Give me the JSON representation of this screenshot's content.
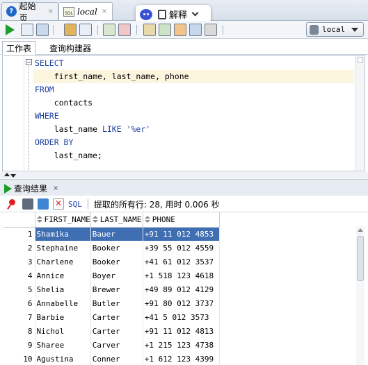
{
  "tabs": [
    {
      "label": "起始页",
      "closable": "×"
    },
    {
      "label": "local",
      "closable": "×"
    }
  ],
  "explain_widget": {
    "label": "解释",
    "icon": "robot-icon"
  },
  "toolbar": {
    "connection": {
      "value": "local"
    },
    "icons": [
      "run-statement-icon",
      "run-script-icon",
      "autotrace-icon",
      "explain-plan-icon",
      "commit-icon",
      "rollback-icon",
      "sql-tuning-icon",
      "format-icon",
      "clear-icon",
      "history-icon",
      "debug-icon"
    ]
  },
  "subtabs": [
    "工作表",
    "查询构建器"
  ],
  "editor": {
    "lines": [
      {
        "kw": "SELECT",
        "rest": ""
      },
      {
        "kw": "",
        "rest": "    first_name, last_name, phone"
      },
      {
        "kw": "FROM",
        "rest": ""
      },
      {
        "kw": "",
        "rest": "    contacts"
      },
      {
        "kw": "WHERE",
        "rest": ""
      },
      {
        "kw": "",
        "rest": "    last_name LIKE '%er'"
      },
      {
        "kw": "ORDER BY",
        "rest": ""
      },
      {
        "kw": "",
        "rest": "    last_name;"
      }
    ]
  },
  "results": {
    "tab_label": "查询结果",
    "tab_close": "×",
    "sql_label": "SQL",
    "status": "提取的所有行: 28, 用时 0.006 秒",
    "columns": [
      "FIRST_NAME",
      "LAST_NAME",
      "PHONE"
    ],
    "rows": [
      [
        "1",
        "Shamika",
        "Bauer",
        "+91 11 012 4853"
      ],
      [
        "2",
        "Stephaine",
        "Booker",
        "+39 55 012 4559"
      ],
      [
        "3",
        "Charlene",
        "Booker",
        "+41 61 012 3537"
      ],
      [
        "4",
        "Annice",
        "Boyer",
        "+1 518 123 4618"
      ],
      [
        "5",
        "Shelia",
        "Brewer",
        "+49 89 012 4129"
      ],
      [
        "6",
        "Annabelle",
        "Butler",
        "+91 80 012 3737"
      ],
      [
        "7",
        "Barbie",
        "Carter",
        "+41 5 012 3573"
      ],
      [
        "8",
        "Nichol",
        "Carter",
        "+91 11 012 4813"
      ],
      [
        "9",
        "Sharee",
        "Carver",
        "+1 215 123 4738"
      ],
      [
        "10",
        "Agustina",
        "Conner",
        "+1 612 123 4399"
      ]
    ],
    "selected_row": 0
  }
}
